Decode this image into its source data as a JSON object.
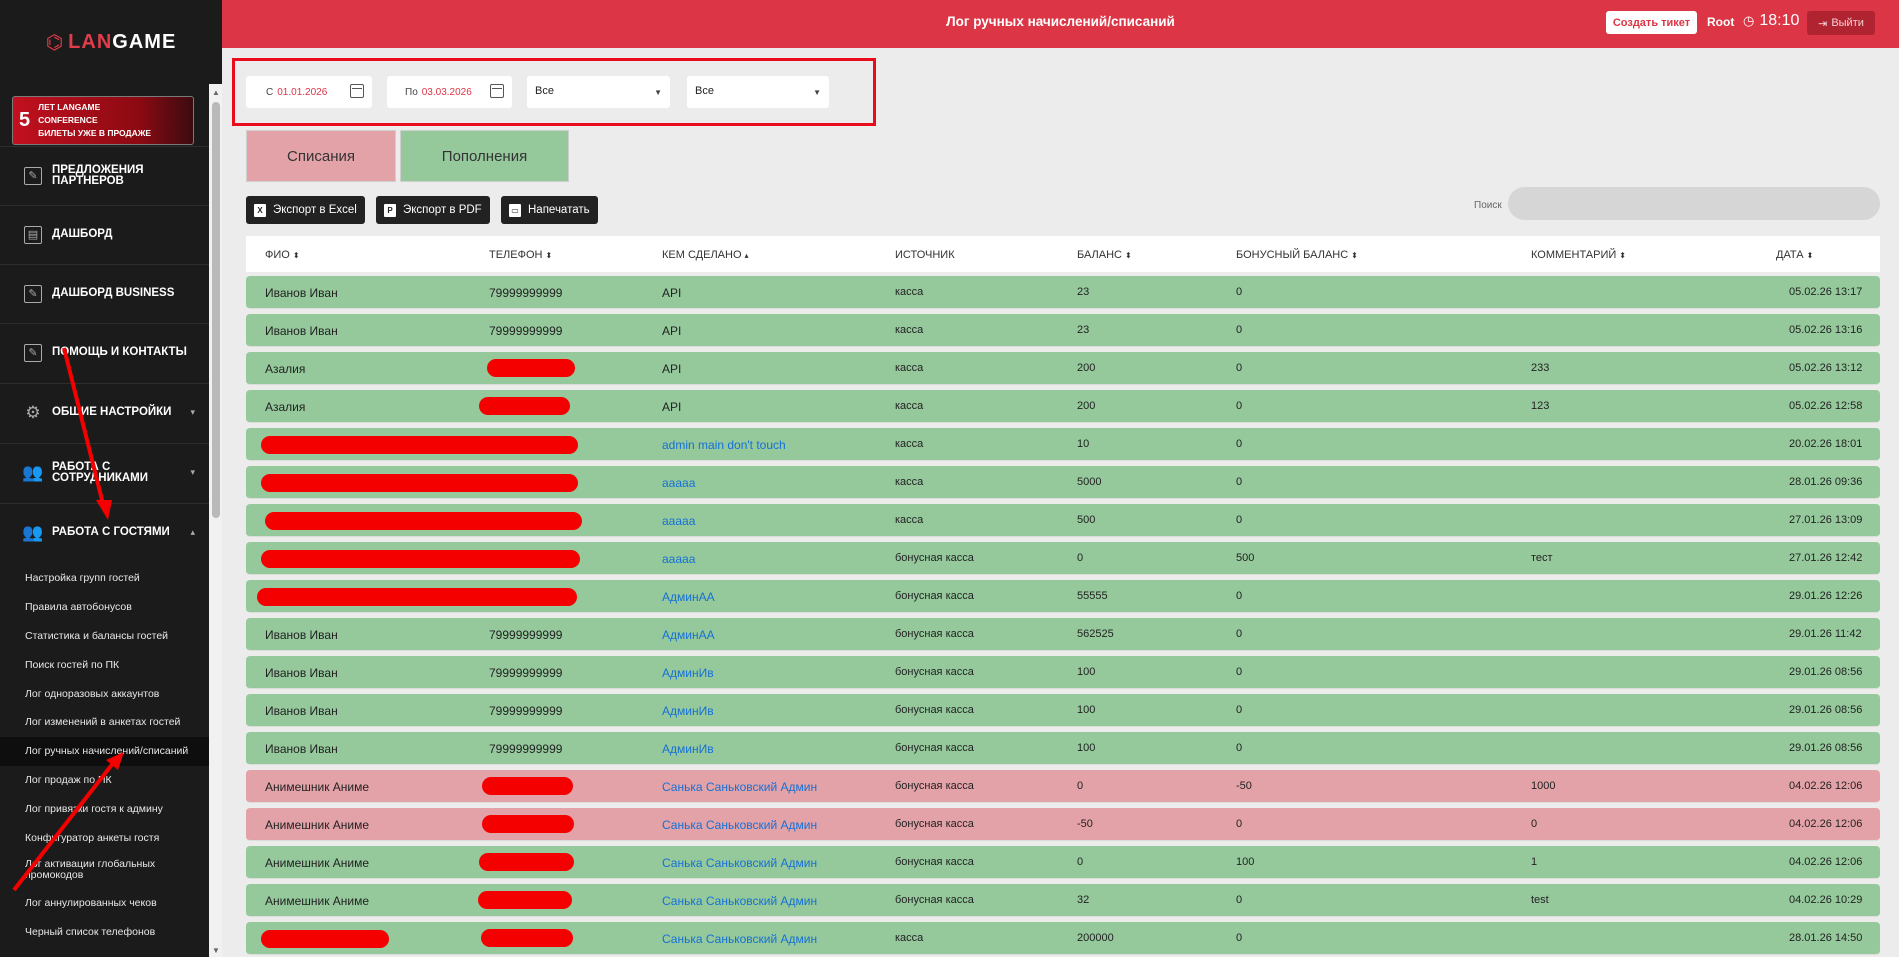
{
  "sidebar": {
    "logo": {
      "mark": "⌬",
      "brand_lan": "LAN",
      "brand_game": "GAME"
    },
    "banner": {
      "num": "5",
      "line1": "ЛЕТ LANGAME",
      "line2": "CONFERENCE",
      "line3": "БИЛЕТЫ УЖЕ В ПРОДАЖЕ"
    },
    "menu": [
      {
        "label": "ПРЕДЛОЖЕНИЯ ПАРТНЕРОВ",
        "icon": "✎"
      },
      {
        "label": "ДАШБОРД",
        "icon": "▤"
      },
      {
        "label": "ДАШБОРД BUSINESS",
        "icon": "✎"
      },
      {
        "label": "ПОМОЩЬ И КОНТАКТЫ",
        "icon": "✎"
      },
      {
        "label": "ОБЩИЕ НАСТРОЙКИ",
        "icon": "⚙"
      },
      {
        "label": "РАБОТА С СОТРУДНИКАМИ",
        "icon": "👥"
      },
      {
        "label": "РАБОТА С ГОСТЯМИ",
        "icon": "👥"
      }
    ],
    "submenu": [
      "Настройка групп гостей",
      "Правила автобонусов",
      "Статистика и балансы гостей",
      "Поиск гостей по ПК",
      "Лог одноразовых аккаунтов",
      "Лог изменений в анкетах гостей",
      "Лог ручных начислений/списаний",
      "Лог продаж по ПК",
      "Лог привязки гостя к админу",
      "Конфигуратор анкеты гостя",
      "Лог активации глобальных промокодов",
      "Лог аннулированных чеков",
      "Черный список телефонов"
    ]
  },
  "header": {
    "title": "Лог ручных начислений/списаний",
    "create_ticket": "Создать тикет",
    "user": "Root",
    "time": "18:10",
    "logout": "Выйти"
  },
  "filters": {
    "from_prefix": "С",
    "from_value": "01.01.2026",
    "to_prefix": "По",
    "to_value": "03.03.2026",
    "select1": "Все",
    "select2": "Все"
  },
  "tabs": {
    "minus": "Списания",
    "plus": "Пополнения"
  },
  "toolbar": {
    "excel": "Экспорт в Excel",
    "pdf": "Экспорт в PDF",
    "print": "Напечатать",
    "search_label": "Поиск"
  },
  "table": {
    "headers": [
      "ФИО",
      "ТЕЛЕФОН",
      "КЕМ СДЕЛАНО",
      "ИСТОЧНИК",
      "БАЛАНС",
      "БОНУСНЫЙ БАЛАНС",
      "КОММЕНТАРИЙ",
      "ДАТА"
    ],
    "rows": [
      {
        "status": "green",
        "name": "Иванов Иван",
        "phone": "79999999999",
        "by": "API",
        "source": "касса",
        "balance": "23",
        "bonus": "0",
        "comment": "",
        "date": "05.02.26 13:17"
      },
      {
        "status": "green",
        "name": "Иванов Иван",
        "phone": "79999999999",
        "by": "API",
        "source": "касса",
        "balance": "23",
        "bonus": "0",
        "comment": "",
        "date": "05.02.26 13:16"
      },
      {
        "status": "green",
        "name": "Азалия",
        "phone": "",
        "by": "API",
        "source": "касса",
        "balance": "200",
        "bonus": "0",
        "comment": "233",
        "date": "05.02.26 13:12"
      },
      {
        "status": "green",
        "name": "Азалия",
        "phone": "",
        "by": "API",
        "source": "касса",
        "balance": "200",
        "bonus": "0",
        "comment": "123",
        "date": "05.02.26 12:58"
      },
      {
        "status": "green",
        "name": "",
        "phone": "",
        "by": "admin main don't touch",
        "source": "касса",
        "balance": "10",
        "bonus": "0",
        "comment": "",
        "date": "20.02.26 18:01"
      },
      {
        "status": "green",
        "name": "",
        "phone": "",
        "by": "ааааа",
        "source": "касса",
        "balance": "5000",
        "bonus": "0",
        "comment": "",
        "date": "28.01.26 09:36"
      },
      {
        "status": "green",
        "name": "",
        "phone": "",
        "by": "ааааа",
        "source": "касса",
        "balance": "500",
        "bonus": "0",
        "comment": "",
        "date": "27.01.26 13:09"
      },
      {
        "status": "green",
        "name": "",
        "phone": "",
        "by": "ааааа",
        "source": "бонусная касса",
        "balance": "0",
        "bonus": "500",
        "comment": "тест",
        "date": "27.01.26 12:42"
      },
      {
        "status": "green",
        "name": "",
        "phone": "",
        "by": "АдминАА",
        "source": "бонусная касса",
        "balance": "55555",
        "bonus": "0",
        "comment": "",
        "date": "29.01.26 12:26"
      },
      {
        "status": "green",
        "name": "Иванов Иван",
        "phone": "79999999999",
        "by": "АдминАА",
        "source": "бонусная касса",
        "balance": "562525",
        "bonus": "0",
        "comment": "",
        "date": "29.01.26 11:42"
      },
      {
        "status": "green",
        "name": "Иванов Иван",
        "phone": "79999999999",
        "by": "АдминИв",
        "source": "бонусная касса",
        "balance": "100",
        "bonus": "0",
        "comment": "",
        "date": "29.01.26 08:56"
      },
      {
        "status": "green",
        "name": "Иванов Иван",
        "phone": "79999999999",
        "by": "АдминИв",
        "source": "бонусная касса",
        "balance": "100",
        "bonus": "0",
        "comment": "",
        "date": "29.01.26 08:56"
      },
      {
        "status": "green",
        "name": "Иванов Иван",
        "phone": "79999999999",
        "by": "АдминИв",
        "source": "бонусная касса",
        "balance": "100",
        "bonus": "0",
        "comment": "",
        "date": "29.01.26 08:56"
      },
      {
        "status": "red",
        "name": "Анимешник Аниме",
        "phone": "",
        "by": "Санька Саньковский Админ",
        "source": "бонусная касса",
        "balance": "0",
        "bonus": "-50",
        "comment": "1000",
        "date": "04.02.26 12:06"
      },
      {
        "status": "red",
        "name": "Анимешник Аниме",
        "phone": "",
        "by": "Санька Саньковский Админ",
        "source": "бонусная касса",
        "balance": "-50",
        "bonus": "0",
        "comment": "0",
        "date": "04.02.26 12:06"
      },
      {
        "status": "green",
        "name": "Анимешник Аниме",
        "phone": "",
        "by": "Санька Саньковский Админ",
        "source": "бонусная касса",
        "balance": "0",
        "bonus": "100",
        "comment": "1",
        "date": "04.02.26 12:06"
      },
      {
        "status": "green",
        "name": "Анимешник Аниме",
        "phone": "",
        "by": "Санька Саньковский Админ",
        "source": "бонусная касса",
        "balance": "32",
        "bonus": "0",
        "comment": "test",
        "date": "04.02.26 10:29"
      },
      {
        "status": "green",
        "name": "",
        "phone": "",
        "by": "Санька Саньковский Админ",
        "source": "касса",
        "balance": "200000",
        "bonus": "0",
        "comment": "",
        "date": "28.01.26 14:50"
      }
    ]
  },
  "colors": {
    "accent": "#dc3545",
    "row_green": "#95c99c",
    "row_red": "#e3a2a8",
    "redaction": "#f40000",
    "link": "#1570d6"
  }
}
